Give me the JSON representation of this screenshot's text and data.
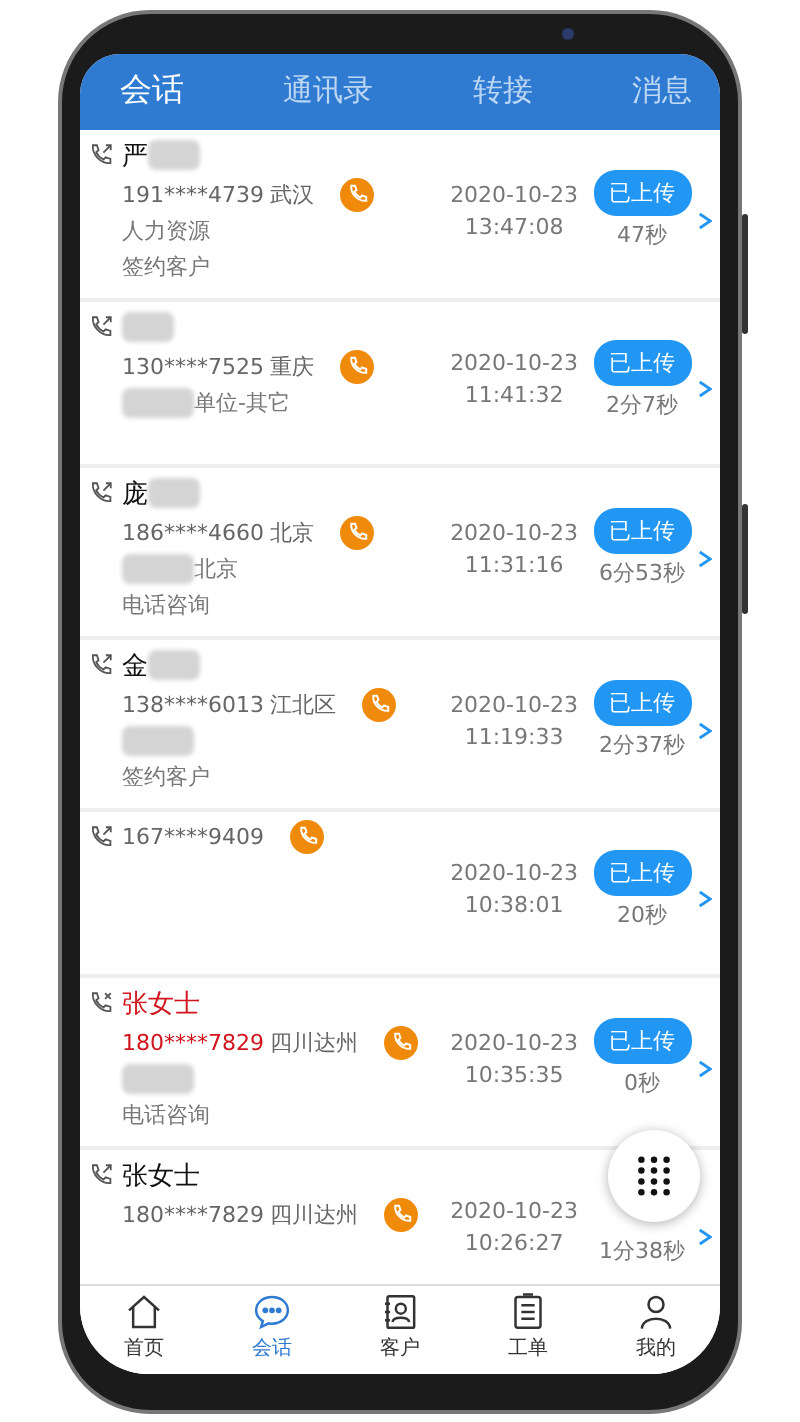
{
  "tabs": [
    {
      "label": "会话",
      "selected": true
    },
    {
      "label": "通讯录",
      "selected": false
    },
    {
      "label": "转接",
      "selected": false
    },
    {
      "label": "消息",
      "selected": false
    }
  ],
  "calls": [
    {
      "kind": "outgoing",
      "name": "严",
      "name_blurred": true,
      "highlight": false,
      "number": "191****4739",
      "location": "武汉",
      "details": [
        {
          "text": "人力资源"
        },
        {
          "text": "签约客户"
        }
      ],
      "date": "2020-10-23",
      "time": "13:47:08",
      "upload": "已上传",
      "duration": "47秒"
    },
    {
      "kind": "outgoing",
      "name_blurred": true,
      "highlight": false,
      "number": "130****7525",
      "location": "重庆",
      "details": [
        {
          "text": "单位-其它",
          "blurred": true
        }
      ],
      "date": "2020-10-23",
      "time": "11:41:32",
      "upload": "已上传",
      "duration": "2分7秒"
    },
    {
      "kind": "outgoing",
      "name": "庞",
      "name_blurred": true,
      "highlight": false,
      "number": "186****4660",
      "location": "北京",
      "details": [
        {
          "text": "北京",
          "blurred": true
        },
        {
          "text": "电话咨询"
        }
      ],
      "date": "2020-10-23",
      "time": "11:31:16",
      "upload": "已上传",
      "duration": "6分53秒"
    },
    {
      "kind": "outgoing",
      "name": "金",
      "name_blurred": true,
      "highlight": false,
      "number": "138****6013",
      "location": "江北区",
      "details": [
        {
          "blurred": true
        },
        {
          "text": "签约客户"
        }
      ],
      "date": "2020-10-23",
      "time": "11:19:33",
      "upload": "已上传",
      "duration": "2分37秒"
    },
    {
      "kind": "outgoing",
      "name_blurred": false,
      "highlight": false,
      "number": "167****9409",
      "date": "2020-10-23",
      "time": "10:38:01",
      "upload": "已上传",
      "duration": "20秒"
    },
    {
      "kind": "missed",
      "name": "张女士",
      "name_blurred": false,
      "highlight": true,
      "number": "180****7829",
      "location": "四川达州",
      "details": [
        {
          "blurred": true
        },
        {
          "text": "电话咨询"
        }
      ],
      "date": "2020-10-23",
      "time": "10:35:35",
      "upload": "已上传",
      "duration": "0秒"
    },
    {
      "kind": "outgoing",
      "name": "张女士",
      "name_blurred": false,
      "highlight": false,
      "number": "180****7829",
      "location": "四川达州",
      "date": "2020-10-23",
      "time": "10:26:27",
      "duration": "1分38秒"
    }
  ],
  "nav": [
    {
      "label": "首页",
      "selected": false
    },
    {
      "label": "会话",
      "selected": true
    },
    {
      "label": "客户",
      "selected": false
    },
    {
      "label": "工单",
      "selected": false
    },
    {
      "label": "我的",
      "selected": false
    }
  ]
}
